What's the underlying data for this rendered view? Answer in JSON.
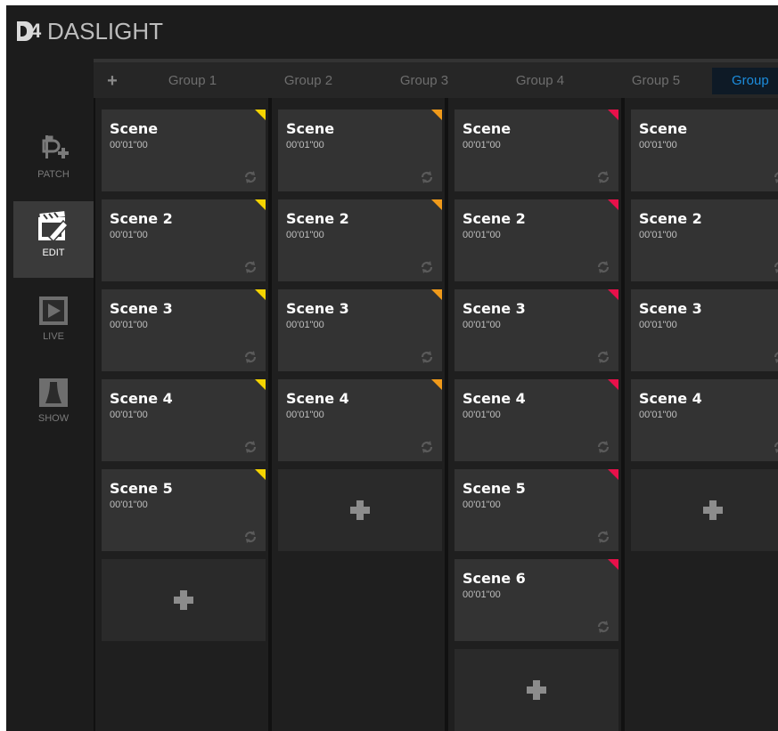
{
  "app": {
    "logo_text": "DASLIGHT",
    "logo_mark": "D4"
  },
  "nav": {
    "items": [
      {
        "id": "patch",
        "label": "PATCH",
        "icon": "patch-icon",
        "active": false
      },
      {
        "id": "edit",
        "label": "EDIT",
        "icon": "edit-clapper-icon",
        "active": true
      },
      {
        "id": "live",
        "label": "LIVE",
        "icon": "play-icon",
        "active": false
      },
      {
        "id": "show",
        "label": "SHOW",
        "icon": "stage-curtain-icon",
        "active": false
      }
    ]
  },
  "tabs": {
    "add_label": "+",
    "items": [
      {
        "label": "Group 1",
        "active": false
      },
      {
        "label": "Group 2",
        "active": false
      },
      {
        "label": "Group 3",
        "active": false
      },
      {
        "label": "Group 4",
        "active": false
      },
      {
        "label": "Group 5",
        "active": false
      },
      {
        "label": "Group",
        "active": true
      }
    ]
  },
  "colors": {
    "yellow_flag": "#f5d400",
    "orange_flag": "#f09a1a",
    "pink_flag": "#e8104a",
    "active_tab": "#1c8cdc"
  },
  "columns": [
    {
      "flag": "yellow_flag",
      "scenes": [
        {
          "name": "Scene",
          "time": "00'01\"00"
        },
        {
          "name": "Scene 2",
          "time": "00'01\"00"
        },
        {
          "name": "Scene 3",
          "time": "00'01\"00"
        },
        {
          "name": "Scene 4",
          "time": "00'01\"00"
        },
        {
          "name": "Scene 5",
          "time": "00'01\"00"
        }
      ]
    },
    {
      "flag": "orange_flag",
      "scenes": [
        {
          "name": "Scene",
          "time": "00'01\"00"
        },
        {
          "name": "Scene 2",
          "time": "00'01\"00"
        },
        {
          "name": "Scene 3",
          "time": "00'01\"00"
        },
        {
          "name": "Scene 4",
          "time": "00'01\"00"
        }
      ]
    },
    {
      "flag": "pink_flag",
      "scenes": [
        {
          "name": "Scene",
          "time": "00'01\"00"
        },
        {
          "name": "Scene 2",
          "time": "00'01\"00"
        },
        {
          "name": "Scene 3",
          "time": "00'01\"00"
        },
        {
          "name": "Scene 4",
          "time": "00'01\"00"
        },
        {
          "name": "Scene 5",
          "time": "00'01\"00"
        },
        {
          "name": "Scene 6",
          "time": "00'01\"00"
        }
      ]
    },
    {
      "flag": "pink_flag",
      "scenes": [
        {
          "name": "Scene",
          "time": "00'01\"00"
        },
        {
          "name": "Scene 2",
          "time": "00'01\"00"
        },
        {
          "name": "Scene 3",
          "time": "00'01\"00"
        },
        {
          "name": "Scene 4",
          "time": "00'01\"00"
        }
      ]
    }
  ]
}
